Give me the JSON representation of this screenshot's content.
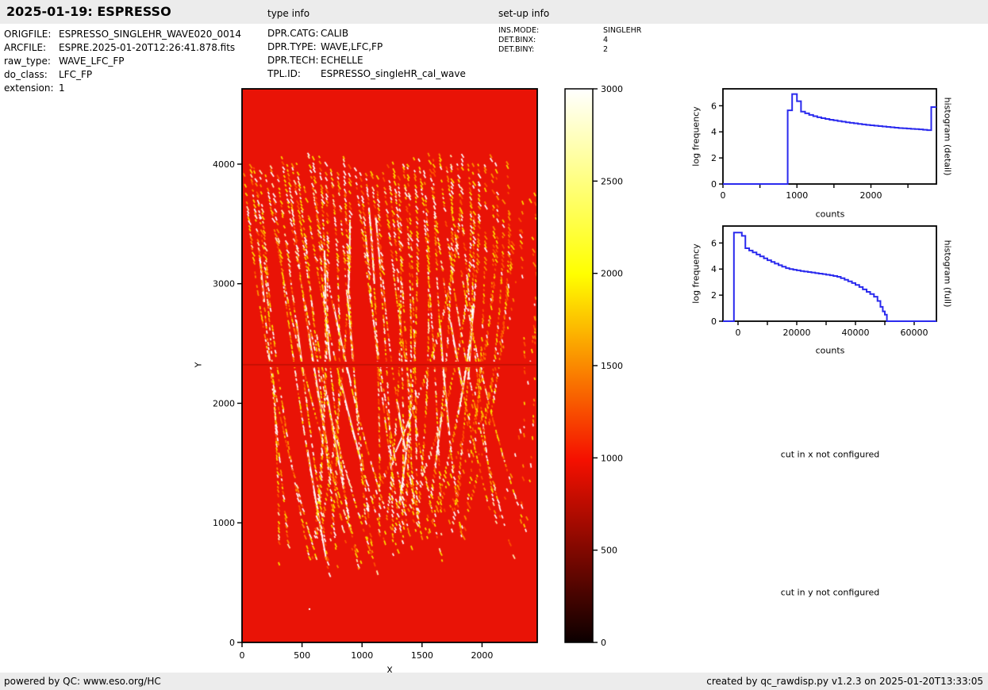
{
  "header": {
    "title": "2025-01-19: ESPRESSO",
    "type_info_label": "type info",
    "setup_info_label": "set-up info"
  },
  "file_info": {
    "rows": [
      {
        "label": "ORIGFILE:",
        "value": "ESPRESSO_SINGLEHR_WAVE020_0014"
      },
      {
        "label": "ARCFILE:",
        "value": "ESPRE.2025-01-20T12:26:41.878.fits"
      },
      {
        "label": "raw_type:",
        "value": "WAVE_LFC_FP"
      },
      {
        "label": "do_class:",
        "value": "LFC_FP"
      },
      {
        "label": "extension:",
        "value": "1"
      }
    ]
  },
  "type_info": {
    "rows": [
      {
        "label": "DPR.CATG:",
        "value": "CALIB"
      },
      {
        "label": "DPR.TYPE:",
        "value": "WAVE,LFC,FP"
      },
      {
        "label": "DPR.TECH:",
        "value": "ECHELLE"
      },
      {
        "label": "TPL.ID:",
        "value": "ESPRESSO_singleHR_cal_wave"
      }
    ]
  },
  "setup_info": {
    "rows": [
      {
        "label": "INS.MODE:",
        "value": "SINGLEHR"
      },
      {
        "label": "DET.BINX:",
        "value": "4"
      },
      {
        "label": "DET.BINY:",
        "value": "2"
      }
    ]
  },
  "messages": {
    "cut_x": "cut in x not configured",
    "cut_y": "cut in y not configured"
  },
  "footer": {
    "left": "powered by QC: www.eso.org/HC",
    "right": "created by qc_rawdisp.py v1.2.3 on 2025-01-20T13:33:05"
  },
  "colors": {
    "bar_bg": "#ececec",
    "text": "#000000",
    "axis": "#000000",
    "hist_line": "#2a2aee",
    "image_red": "#e91306",
    "gap_line": "#c21103",
    "stripe_colors": [
      "#ffffff",
      "#fff3b8",
      "#ffdf00",
      "#ff9400",
      "#ff5400"
    ]
  },
  "chart_data": [
    {
      "id": "raw_frame_image",
      "type": "heatmap",
      "title": "",
      "xlabel": "X",
      "ylabel": "Y",
      "xlim": [
        0,
        2460
      ],
      "ylim": [
        0,
        4630
      ],
      "xticks": [
        0,
        500,
        1000,
        1500,
        2000
      ],
      "yticks": [
        0,
        1000,
        2000,
        3000,
        4000
      ],
      "colormap": "hot",
      "vmin": 0,
      "vmax": 3000,
      "description": "ESPRESSO raw WAVE_LFC_FP echelle frame: bright red background (counts ~1000) covered by dense near-vertical columns of short white/yellow/orange dashes (LFC+FP lines along curved echelle orders). Pattern spans y~500 to y~4100; plain red above and below; stripes fade and get sparser toward the right edge; dark detector gap row at y~2320 crossing the full width; single tiny white dot near (555, 280)."
    },
    {
      "id": "colorbar",
      "type": "colorbar",
      "colormap": "hot",
      "vmin": 0,
      "vmax": 3000,
      "ticks": [
        0,
        500,
        1000,
        1500,
        2000,
        2500,
        3000
      ]
    },
    {
      "id": "histogram_detail",
      "type": "line",
      "right_label": "histogram (detail)",
      "xlabel": "counts",
      "ylabel": "log frequency",
      "xlim": [
        0,
        2885
      ],
      "ylim": [
        0,
        7.3
      ],
      "xticks_labeled": [
        0,
        1000,
        2000
      ],
      "xticks_unlabeled": [
        500,
        1500,
        2500
      ],
      "yticks": [
        0,
        2,
        4,
        6
      ],
      "steps": [
        [
          0,
          0
        ],
        [
          875,
          5.65
        ],
        [
          935,
          6.9
        ],
        [
          1000,
          6.35
        ],
        [
          1055,
          5.55
        ],
        [
          1110,
          5.42
        ],
        [
          1165,
          5.3
        ],
        [
          1220,
          5.2
        ],
        [
          1275,
          5.12
        ],
        [
          1330,
          5.05
        ],
        [
          1385,
          4.99
        ],
        [
          1440,
          4.93
        ],
        [
          1495,
          4.88
        ],
        [
          1550,
          4.83
        ],
        [
          1605,
          4.78
        ],
        [
          1660,
          4.73
        ],
        [
          1715,
          4.69
        ],
        [
          1770,
          4.65
        ],
        [
          1825,
          4.61
        ],
        [
          1880,
          4.57
        ],
        [
          1935,
          4.53
        ],
        [
          1990,
          4.5
        ],
        [
          2045,
          4.47
        ],
        [
          2100,
          4.44
        ],
        [
          2155,
          4.41
        ],
        [
          2210,
          4.38
        ],
        [
          2265,
          4.35
        ],
        [
          2320,
          4.32
        ],
        [
          2375,
          4.29
        ],
        [
          2430,
          4.27
        ],
        [
          2485,
          4.25
        ],
        [
          2540,
          4.23
        ],
        [
          2595,
          4.21
        ],
        [
          2650,
          4.19
        ],
        [
          2705,
          4.16
        ],
        [
          2760,
          4.13
        ],
        [
          2815,
          5.9
        ]
      ]
    },
    {
      "id": "histogram_full",
      "type": "line",
      "right_label": "histogram (full)",
      "xlabel": "counts",
      "ylabel": "log frequency",
      "xlim": [
        -5135,
        67570
      ],
      "ylim": [
        0,
        7.3
      ],
      "xticks_labeled": [
        0,
        20000,
        40000,
        60000
      ],
      "xticks_unlabeled": [
        10000,
        30000,
        50000
      ],
      "yticks": [
        0,
        2,
        4,
        6
      ],
      "steps": [
        [
          -5135,
          0
        ],
        [
          -1400,
          6.8
        ],
        [
          1300,
          6.55
        ],
        [
          2500,
          5.6
        ],
        [
          3800,
          5.42
        ],
        [
          5000,
          5.28
        ],
        [
          6300,
          5.12
        ],
        [
          7500,
          4.97
        ],
        [
          8800,
          4.82
        ],
        [
          10000,
          4.68
        ],
        [
          11300,
          4.55
        ],
        [
          12500,
          4.42
        ],
        [
          13800,
          4.3
        ],
        [
          15000,
          4.18
        ],
        [
          16300,
          4.07
        ],
        [
          17500,
          4.0
        ],
        [
          18800,
          3.95
        ],
        [
          20000,
          3.9
        ],
        [
          21300,
          3.85
        ],
        [
          22500,
          3.81
        ],
        [
          23800,
          3.77
        ],
        [
          25000,
          3.73
        ],
        [
          26300,
          3.69
        ],
        [
          27500,
          3.65
        ],
        [
          28800,
          3.61
        ],
        [
          30000,
          3.57
        ],
        [
          31300,
          3.52
        ],
        [
          32500,
          3.47
        ],
        [
          33800,
          3.41
        ],
        [
          35000,
          3.3
        ],
        [
          36300,
          3.18
        ],
        [
          37500,
          3.06
        ],
        [
          38800,
          2.93
        ],
        [
          40000,
          2.78
        ],
        [
          41300,
          2.62
        ],
        [
          42500,
          2.44
        ],
        [
          43800,
          2.25
        ],
        [
          45000,
          2.08
        ],
        [
          46300,
          1.88
        ],
        [
          47500,
          1.55
        ],
        [
          48500,
          1.1
        ],
        [
          49300,
          0.75
        ],
        [
          50000,
          0.5
        ],
        [
          50700,
          0
        ]
      ]
    }
  ]
}
